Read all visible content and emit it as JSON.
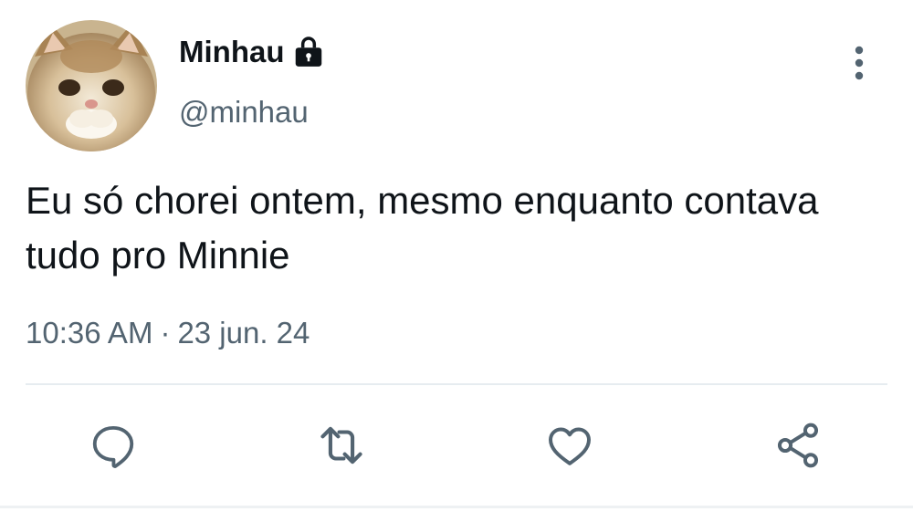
{
  "user": {
    "display_name": "Minhau",
    "handle": "@minhau",
    "verified_icon": "lock-icon",
    "avatar": "cat-avatar"
  },
  "tweet": {
    "text": "Eu só chorei ontem, mesmo enquanto contava tudo pro Minnie",
    "time": "10:36 AM",
    "separator": "·",
    "date": "23 jun. 24"
  },
  "actions": {
    "reply_icon": "reply-icon",
    "retweet_icon": "retweet-icon",
    "like_icon": "heart-icon",
    "share_icon": "share-icon",
    "more_icon": "more-vertical-icon"
  },
  "colors": {
    "text_primary": "#0f1419",
    "text_secondary": "#536471",
    "icon": "#536471",
    "divider": "#e6ecf0"
  }
}
